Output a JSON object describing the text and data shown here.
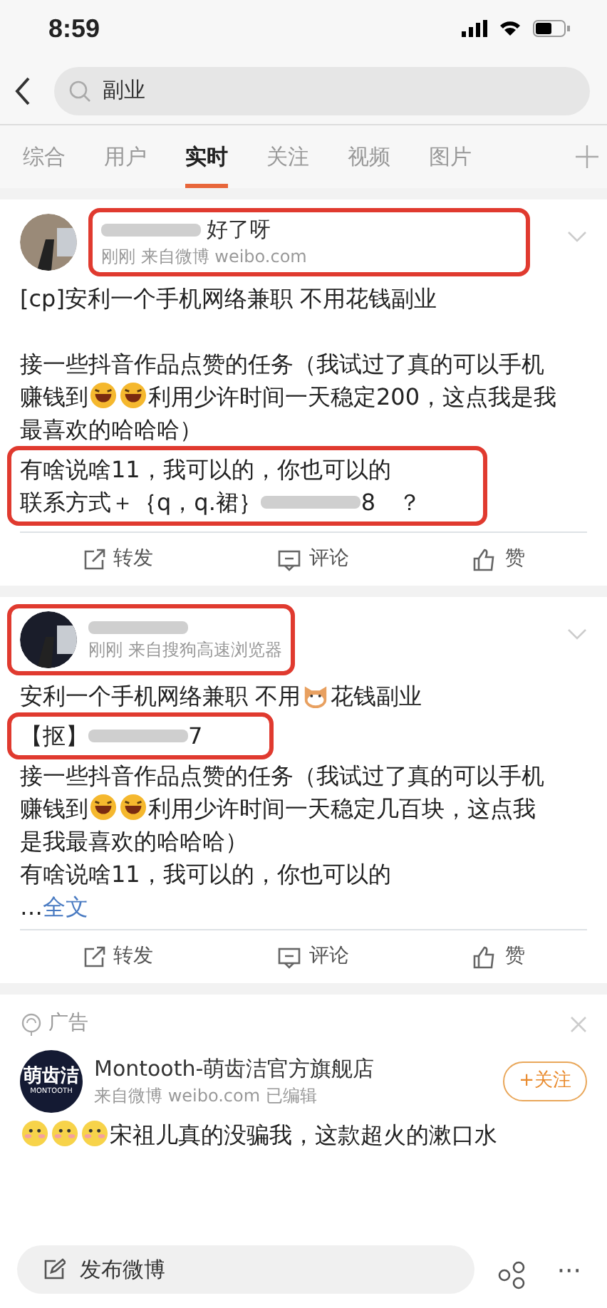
{
  "status_bar": {
    "time": "8:59"
  },
  "search": {
    "value": "副业"
  },
  "tabs": [
    {
      "label": "综合",
      "selected": false
    },
    {
      "label": "用户",
      "selected": false
    },
    {
      "label": "实时",
      "selected": true
    },
    {
      "label": "关注",
      "selected": false
    },
    {
      "label": "视频",
      "selected": false
    },
    {
      "label": "图片",
      "selected": false
    }
  ],
  "posts": [
    {
      "name": [
        {
          "kind": "blur"
        },
        {
          "kind": "text",
          "text": "好了呀"
        }
      ],
      "meta": "刚刚  来自微博 weibo.com",
      "header_highlighted": true,
      "paragraphs": [
        {
          "lines": [
            {
              "parts": [
                {
                  "kind": "text",
                  "text": "[cp]安利一个手机网络兼职 不用花钱副业"
                }
              ]
            }
          ]
        },
        {
          "lines": [
            {
              "parts": [
                {
                  "kind": "text",
                  "text": "接一些抖音作品点赞的任务（我试过了真的可以手机"
                }
              ]
            },
            {
              "parts": [
                {
                  "kind": "text",
                  "text": "赚钱到"
                },
                {
                  "kind": "laugh"
                },
                {
                  "kind": "laugh"
                },
                {
                  "kind": "text",
                  "text": "利用少许时间一天稳定200，这点我是我"
                }
              ]
            },
            {
              "parts": [
                {
                  "kind": "text",
                  "text": "最喜欢的哈哈哈）"
                }
              ]
            },
            {
              "highlighted": true,
              "parts": [
                {
                  "kind": "text",
                  "text": "有啥说啥11，我可以的，你也可以的"
                }
              ]
            },
            {
              "highlighted": true,
              "parts": [
                {
                  "kind": "text",
                  "text": "联系方式＋｛q，q.裙｝"
                },
                {
                  "kind": "blur"
                },
                {
                  "kind": "text",
                  "text": "8　？"
                }
              ]
            }
          ]
        }
      ],
      "actions": [
        "转发",
        "评论",
        "赞"
      ]
    },
    {
      "name": [
        {
          "kind": "blur"
        }
      ],
      "meta": "刚刚  来自搜狗高速浏览器",
      "header_highlighted": true,
      "paragraphs": [
        {
          "lines": [
            {
              "parts": [
                {
                  "kind": "text",
                  "text": "安利一个手机网络兼职 不用"
                },
                {
                  "kind": "cat"
                },
                {
                  "kind": "text",
                  "text": "花钱副业"
                }
              ]
            },
            {
              "highlighted": true,
              "parts": [
                {
                  "kind": "text",
                  "text": "【抠】"
                },
                {
                  "kind": "blur"
                },
                {
                  "kind": "text",
                  "text": "7"
                }
              ]
            },
            {
              "parts": [
                {
                  "kind": "text",
                  "text": "接一些抖音作品点赞的任务（我试过了真的可以手机"
                }
              ]
            },
            {
              "parts": [
                {
                  "kind": "text",
                  "text": "赚钱到"
                },
                {
                  "kind": "laugh"
                },
                {
                  "kind": "laugh"
                },
                {
                  "kind": "text",
                  "text": "利用少许时间一天稳定几百块，这点我"
                }
              ]
            },
            {
              "parts": [
                {
                  "kind": "text",
                  "text": "是我最喜欢的哈哈哈）"
                }
              ]
            },
            {
              "parts": [
                {
                  "kind": "text",
                  "text": "有啥说啥11，我可以的，你也可以的"
                }
              ]
            },
            {
              "parts": [
                {
                  "kind": "text",
                  "text": "…"
                },
                {
                  "kind": "link",
                  "text": "全文"
                }
              ]
            }
          ]
        }
      ],
      "actions": [
        "转发",
        "评论",
        "赞"
      ]
    }
  ],
  "ad": {
    "label": "广告",
    "logo": "萌齿洁",
    "logo_sub": "MONTOOTH",
    "name": "Montooth-萌齿洁官方旗舰店",
    "meta": "来自微博 weibo.com  已编辑",
    "follow": "+关注",
    "parts": [
      {
        "kind": "shy"
      },
      {
        "kind": "shy"
      },
      {
        "kind": "shy"
      },
      {
        "kind": "text",
        "text": "宋祖儿真的没骗我，这款超火的漱口水"
      }
    ]
  },
  "bottom_bar": {
    "compose": "发布微博",
    "more": "···"
  }
}
